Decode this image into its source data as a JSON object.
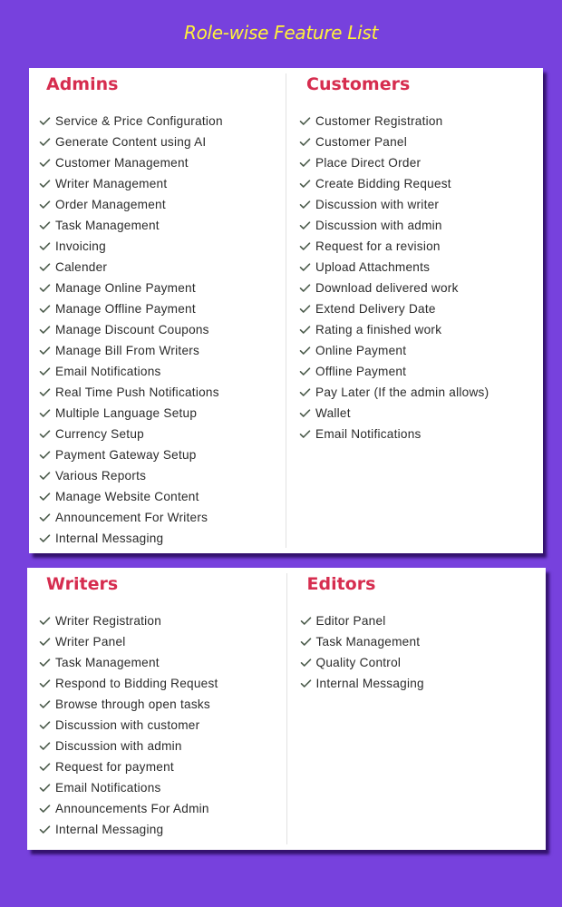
{
  "title": "Role-wise Feature List",
  "colors": {
    "background": "#7741dd",
    "title": "#fff23a",
    "role_heading": "#d62d4f",
    "check": "#4a5a4a"
  },
  "icons": {
    "feature_bullet": "check-icon"
  },
  "roles": {
    "admins": {
      "title": "Admins",
      "features": [
        "Service & Price Configuration",
        "Generate Content using AI",
        "Customer Management",
        "Writer Management",
        "Order Management",
        "Task Management",
        "Invoicing",
        "Calender",
        "Manage Online Payment",
        "Manage Offline Payment",
        "Manage Discount Coupons",
        "Manage Bill From Writers",
        "Email Notifications",
        "Real Time Push Notifications",
        "Multiple Language Setup",
        "Currency Setup",
        "Payment Gateway Setup",
        "Various Reports",
        "Manage Website Content",
        "Announcement For Writers",
        "Internal Messaging"
      ]
    },
    "customers": {
      "title": "Customers",
      "features": [
        "Customer Registration",
        "Customer Panel",
        "Place Direct Order",
        "Create Bidding Request",
        "Discussion with writer",
        "Discussion with admin",
        "Request for a revision",
        "Upload Attachments",
        "Download delivered work",
        "Extend Delivery Date",
        "Rating a finished work",
        "Online Payment",
        "Offline Payment",
        "Pay Later (If the admin allows)",
        "Wallet",
        "Email Notifications"
      ]
    },
    "writers": {
      "title": "Writers",
      "features": [
        "Writer Registration",
        "Writer Panel",
        "Task Management",
        "Respond to Bidding Request",
        "Browse through open tasks",
        "Discussion with customer",
        "Discussion with admin",
        "Request for payment",
        "Email Notifications",
        "Announcements For Admin",
        "Internal Messaging"
      ]
    },
    "editors": {
      "title": "Editors",
      "features": [
        "Editor Panel",
        "Task Management",
        "Quality Control",
        "Internal Messaging"
      ]
    }
  }
}
